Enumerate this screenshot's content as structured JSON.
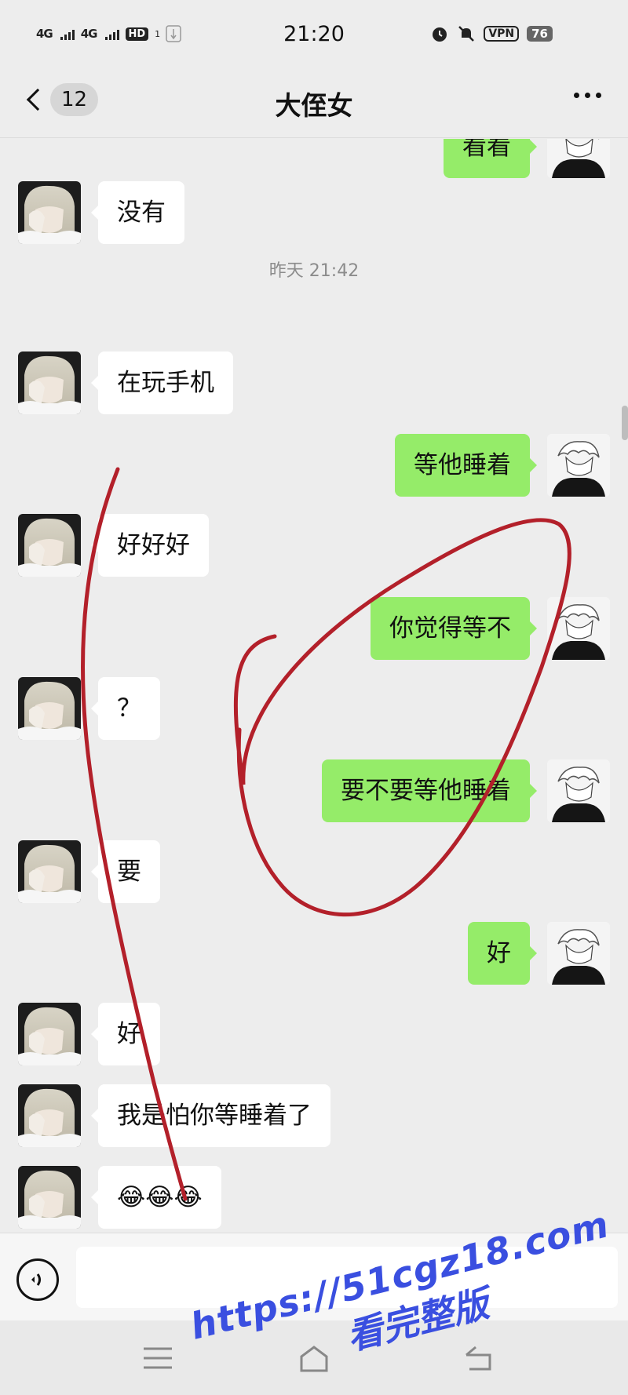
{
  "status_bar": {
    "signal_1": "4G",
    "signal_2": "4G",
    "hd": "HD",
    "hd_sub": "1",
    "time": "21:20",
    "vpn": "VPN",
    "battery": "76"
  },
  "header": {
    "unread_count": "12",
    "title": "大侄女"
  },
  "messages": [
    {
      "side": "right",
      "text": "看看"
    },
    {
      "side": "left",
      "text": "没有"
    },
    {
      "side": "left",
      "text": "在玩手机"
    },
    {
      "side": "right",
      "text": "等他睡着"
    },
    {
      "side": "left",
      "text": "好好好"
    },
    {
      "side": "right",
      "text": "你觉得等不"
    },
    {
      "side": "left",
      "text": "？"
    },
    {
      "side": "right",
      "text": "要不要等他睡着"
    },
    {
      "side": "left",
      "text": "要"
    },
    {
      "side": "right",
      "text": "好"
    },
    {
      "side": "left",
      "text": "好"
    },
    {
      "side": "left",
      "text": "我是怕你等睡着了"
    },
    {
      "side": "left",
      "text": "😂😂😂"
    }
  ],
  "timestamp": "昨天 21:42",
  "input": {
    "value": "",
    "placeholder": ""
  },
  "watermark": {
    "url": "https://51cgz18.com",
    "subtitle": "看完整版"
  },
  "colors": {
    "background": "#ededed",
    "bubble_self": "#95ec69",
    "bubble_other": "#ffffff",
    "annotation_stroke": "#b3202a",
    "watermark": "#3a4fe0"
  },
  "icons": {
    "back": "chevron-left-icon",
    "more": "more-dots-icon",
    "voice": "voice-icon",
    "alarm": "alarm-icon",
    "mute": "mute-icon"
  }
}
